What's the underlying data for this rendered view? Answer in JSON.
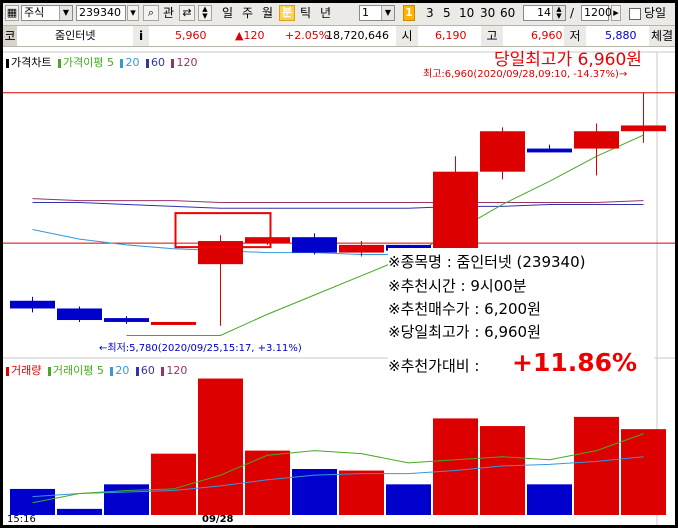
{
  "toolbar": {
    "market_type": "주식",
    "stock_code": "239340",
    "watch_label": "관",
    "period_buttons": [
      "일",
      "주",
      "월",
      "분",
      "틱",
      "년"
    ],
    "interval_value": "1",
    "minute_buttons": [
      "1",
      "3",
      "5",
      "10",
      "30",
      "60"
    ],
    "count_value": "14",
    "slash": "/",
    "total_count": "1200",
    "day_checkbox_label": "당일"
  },
  "quote_bar": {
    "code_tag": "코",
    "stock_name": "줌인터넷",
    "info_label": "i",
    "price": "5,960",
    "change": "▲120",
    "change_pct": "+2.05%",
    "volume": "18,720,646",
    "open_label": "시",
    "open_value": "6,190",
    "high_label": "고",
    "high_value": "6,960",
    "low_label": "저",
    "low_value": "5,880",
    "extra_label": "체결"
  },
  "price_panel": {
    "legend_title": "가격차트",
    "legend_ma": "가격이평 5",
    "legend_ma_periods": [
      "20",
      "60",
      "120"
    ],
    "high_banner": "당일최고가 6,960원",
    "high_marker": "최고:6,960(2020/09/28,09:10, -14.37%)→",
    "low_marker": "←최저:5,780(2020/09/25,15:17, +3.11%)"
  },
  "recommendation": {
    "lines": [
      "※종목명 : 줌인터넷 (239340)",
      "※추천시간 : 9시00분",
      "※추천매수가 : 6,200원",
      "※당일최고가 : 6,960원"
    ],
    "compare_label": "※추천가대비 :",
    "compare_value": "+11.86%"
  },
  "volume_panel": {
    "legend_title": "거래량",
    "legend_ma": "거래이평 5",
    "legend_ma_periods": [
      "20",
      "60",
      "120"
    ]
  },
  "x_axis": {
    "labels": [
      "15:16",
      "09/28"
    ]
  },
  "colors": {
    "up": "#dd0000",
    "down": "#0000cc",
    "ma5": "#44aa22",
    "ma20": "#3399dd",
    "ma60": "#3333aa",
    "ma120": "#993366",
    "accent_red": "#ee0000"
  },
  "chart_data": {
    "type": "candlestick",
    "price_unit": "KRW",
    "candles": [
      {
        "open": 5880,
        "close": 5840,
        "high": 5900,
        "low": 5820
      },
      {
        "open": 5840,
        "close": 5780,
        "high": 5850,
        "low": 5770
      },
      {
        "open": 5790,
        "close": 5770,
        "high": 5800,
        "low": 5760
      },
      {
        "open": 5770,
        "close": 5770,
        "high": 5770,
        "low": 5770
      },
      {
        "open": 6070,
        "close": 6190,
        "high": 6220,
        "low": 5750
      },
      {
        "open": 6180,
        "close": 6210,
        "high": 6210,
        "low": 6170
      },
      {
        "open": 6210,
        "close": 6130,
        "high": 6230,
        "low": 6120
      },
      {
        "open": 6130,
        "close": 6170,
        "high": 6190,
        "low": 6110
      },
      {
        "open": 6170,
        "close": 6140,
        "high": 6170,
        "low": 6110
      },
      {
        "open": 6140,
        "close": 6550,
        "high": 6630,
        "low": 6140
      },
      {
        "open": 6550,
        "close": 6760,
        "high": 6780,
        "low": 6510
      },
      {
        "open": 6670,
        "close": 6650,
        "high": 6690,
        "low": 6650
      },
      {
        "open": 6670,
        "close": 6760,
        "high": 6800,
        "low": 6530
      },
      {
        "open": 6760,
        "close": 6790,
        "high": 6960,
        "low": 6700
      }
    ],
    "volume": [
      170,
      40,
      200,
      400,
      890,
      420,
      300,
      290,
      200,
      630,
      580,
      200,
      640,
      560
    ],
    "volume_ma5": [
      80,
      140,
      160,
      170,
      260,
      390,
      420,
      400,
      340,
      360,
      380,
      360,
      420,
      530
    ],
    "volume_ma20": [
      120,
      140,
      150,
      160,
      190,
      230,
      260,
      270,
      270,
      290,
      320,
      330,
      350,
      380
    ],
    "ma5_price": [
      null,
      null,
      5700,
      5700,
      5700,
      5810,
      5910,
      6010,
      6110,
      6240,
      6380,
      6500,
      6630,
      6740
    ],
    "ma20_price": [
      6250,
      6200,
      6170,
      6150,
      6140,
      6130,
      6130,
      6120,
      6120,
      6120,
      6120,
      6120,
      6120,
      6120
    ],
    "ma60_price": [
      6390,
      6390,
      6380,
      6370,
      6360,
      6360,
      6360,
      6360,
      6360,
      6370,
      6370,
      6380,
      6380,
      6380
    ],
    "ma120_price": [
      6410,
      6400,
      6400,
      6400,
      6390,
      6390,
      6390,
      6390,
      6390,
      6390,
      6390,
      6390,
      6390,
      6400
    ],
    "recommend_price": 6200,
    "day_high": 6960,
    "period_low": 5780
  }
}
